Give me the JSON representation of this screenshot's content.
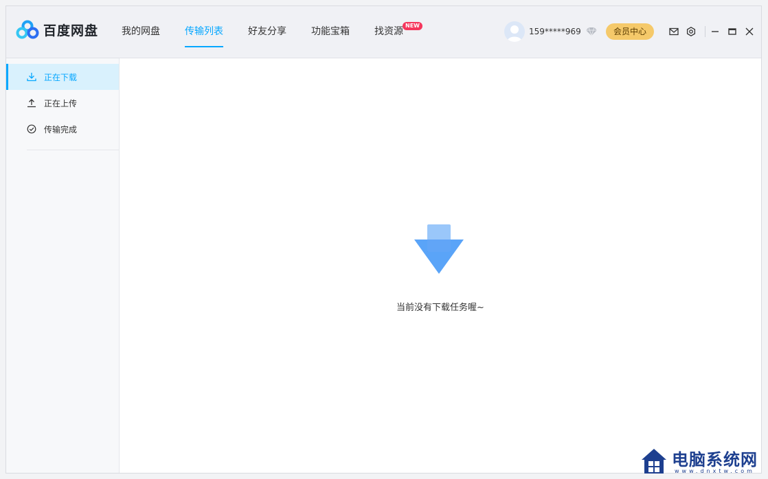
{
  "app": {
    "name": "百度网盘"
  },
  "nav": {
    "items": [
      {
        "label": "我的网盘"
      },
      {
        "label": "传输列表"
      },
      {
        "label": "好友分享"
      },
      {
        "label": "功能宝箱"
      },
      {
        "label": "找资源",
        "badge": "NEW"
      }
    ]
  },
  "user": {
    "name": "159*****969",
    "vip_label": "会员中心"
  },
  "sidebar": {
    "items": [
      {
        "label": "正在下载"
      },
      {
        "label": "正在上传"
      },
      {
        "label": "传输完成"
      }
    ]
  },
  "main": {
    "empty_message": "当前没有下载任务喔~"
  },
  "watermark": {
    "title": "电脑系统网",
    "url": "www.dnxtw.com"
  },
  "colors": {
    "accent": "#06a7ff",
    "vip": "#f5c96a",
    "badge": "#f5365c",
    "sidebar_active_bg": "#d9f1fd"
  },
  "icons": {
    "logo": "baidu-cloud-logo",
    "download": "download-icon",
    "upload": "upload-icon",
    "done": "check-circle-icon",
    "mail": "mail-icon",
    "settings": "gear-icon",
    "minimize": "minimize-icon",
    "maximize": "maximize-icon",
    "close": "close-icon"
  }
}
